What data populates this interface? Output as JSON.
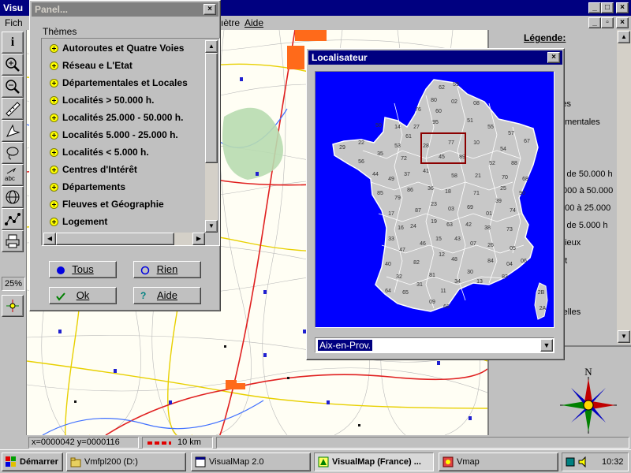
{
  "main_window": {
    "title": "Visu",
    "menu": [
      {
        "label": "Fich"
      },
      {
        "label": "ıètre"
      },
      {
        "label": "Aide"
      }
    ]
  },
  "toolbar": {
    "zoom_level": "25%",
    "tools": [
      "info-icon",
      "zoom-in-icon",
      "zoom-out-icon",
      "ruler-icon",
      "move-icon",
      "lasso-icon",
      "text-label-icon",
      "globe-icon",
      "route-icon",
      "print-icon",
      "compass-tool-icon"
    ]
  },
  "legend": {
    "title": "Légende:",
    "items": [
      {
        "label": "les"
      },
      {
        "label": "ementales"
      },
      {
        "label": "s de 50.000 h"
      },
      {
        "label": ".000 à 50.000"
      },
      {
        "label": "000 à 25.000"
      },
      {
        "label": "s de 5.000 h"
      },
      {
        "label": "gieux"
      },
      {
        "label": "ét"
      },
      {
        "label": "relles"
      }
    ],
    "compass_label": "N"
  },
  "panel": {
    "title": "Panel...",
    "themes_label": "Thèmes",
    "themes": [
      {
        "label": "Autoroutes et Quatre Voies"
      },
      {
        "label": "Réseau e L'Etat"
      },
      {
        "label": "Départementales et Locales"
      },
      {
        "label": "Localités > 50.000 h."
      },
      {
        "label": "Localités 25.000 - 50.000 h."
      },
      {
        "label": "Localités 5.000 - 25.000 h."
      },
      {
        "label": "Localités < 5.000 h."
      },
      {
        "label": "Centres d'Intérêt"
      },
      {
        "label": "Départements"
      },
      {
        "label": "Fleuves et Géographie"
      },
      {
        "label": "Logement"
      }
    ],
    "buttons": {
      "tous": "Tous",
      "rien": "Rien",
      "ok": "Ok",
      "aide": "Aide"
    }
  },
  "localisateur": {
    "title": "Localisateur",
    "selected_city": "Aix-en-Prov.",
    "department_numbers": [
      "62",
      "59",
      "80",
      "02",
      "08",
      "76",
      "60",
      "14",
      "50",
      "27",
      "95",
      "51",
      "55",
      "57",
      "67",
      "29",
      "22",
      "35",
      "53",
      "61",
      "28",
      "77",
      "10",
      "54",
      "88",
      "56",
      "72",
      "45",
      "89",
      "52",
      "70",
      "68",
      "44",
      "49",
      "37",
      "41",
      "58",
      "21",
      "25",
      "90",
      "85",
      "79",
      "86",
      "36",
      "18",
      "71",
      "39",
      "17",
      "16",
      "87",
      "23",
      "03",
      "69",
      "01",
      "74",
      "33",
      "24",
      "19",
      "63",
      "42",
      "38",
      "73",
      "47",
      "46",
      "15",
      "43",
      "07",
      "26",
      "05",
      "40",
      "82",
      "12",
      "48",
      "84",
      "04",
      "06",
      "32",
      "81",
      "30",
      "13",
      "83",
      "64",
      "65",
      "31",
      "11",
      "34",
      "09",
      "66",
      "2B",
      "2A"
    ]
  },
  "statusbar": {
    "coords": "x=0000042 y=0000116",
    "scale": "10 km"
  },
  "taskbar": {
    "start": "Démarrer",
    "tasks": [
      {
        "label": "Vmfpl200 (D:)"
      },
      {
        "label": "VisualMap 2.0"
      },
      {
        "label": "VisualMap  (France) ..."
      },
      {
        "label": "Vmap"
      }
    ],
    "clock": "10:32"
  },
  "colors": {
    "title_active": "#000080",
    "title_inactive": "#808080",
    "face": "#c0c0c0",
    "locator_sea": "#0000ff",
    "locator_land": "#c8c8c8",
    "locator_frame": "#8b0000",
    "map_paper": "#fffef4"
  }
}
